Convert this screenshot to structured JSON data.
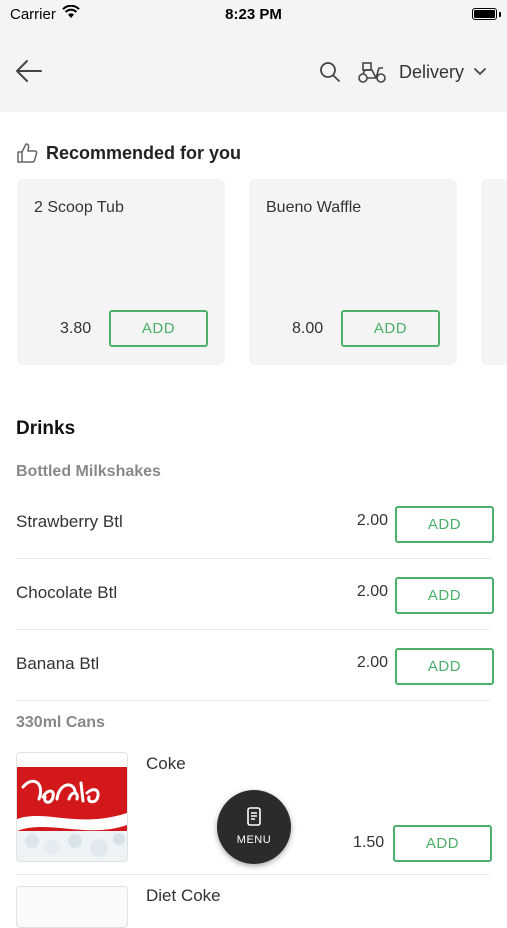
{
  "status_bar": {
    "carrier": "Carrier",
    "time": "8:23 PM"
  },
  "nav": {
    "delivery_label": "Delivery",
    "icons": [
      "back-arrow-icon",
      "search-icon",
      "scooter-icon",
      "chevron-down-icon"
    ]
  },
  "recommended": {
    "title": "Recommended for you",
    "items": [
      {
        "name": "2 Scoop Tub",
        "price": "3.80",
        "add_label": "ADD"
      },
      {
        "name": "Bueno Waffle",
        "price": "8.00",
        "add_label": "ADD"
      }
    ]
  },
  "drinks": {
    "heading": "Drinks",
    "bottled": {
      "title": "Bottled Milkshakes",
      "items": [
        {
          "name": "Strawberry Btl",
          "price": "2.00",
          "add_label": "ADD"
        },
        {
          "name": "Chocolate Btl",
          "price": "2.00",
          "add_label": "ADD"
        },
        {
          "name": "Banana Btl",
          "price": "2.00",
          "add_label": "ADD"
        }
      ]
    },
    "cans": {
      "title": "330ml Cans",
      "items": [
        {
          "name": "Coke",
          "price": "1.50",
          "add_label": "ADD"
        },
        {
          "name": "Diet Coke"
        }
      ]
    }
  },
  "menu_button": {
    "label": "MENU"
  },
  "colors": {
    "accent": "#4caf6a",
    "nav_bg": "#f4f4f4",
    "fab_bg": "#2b2b2b"
  }
}
